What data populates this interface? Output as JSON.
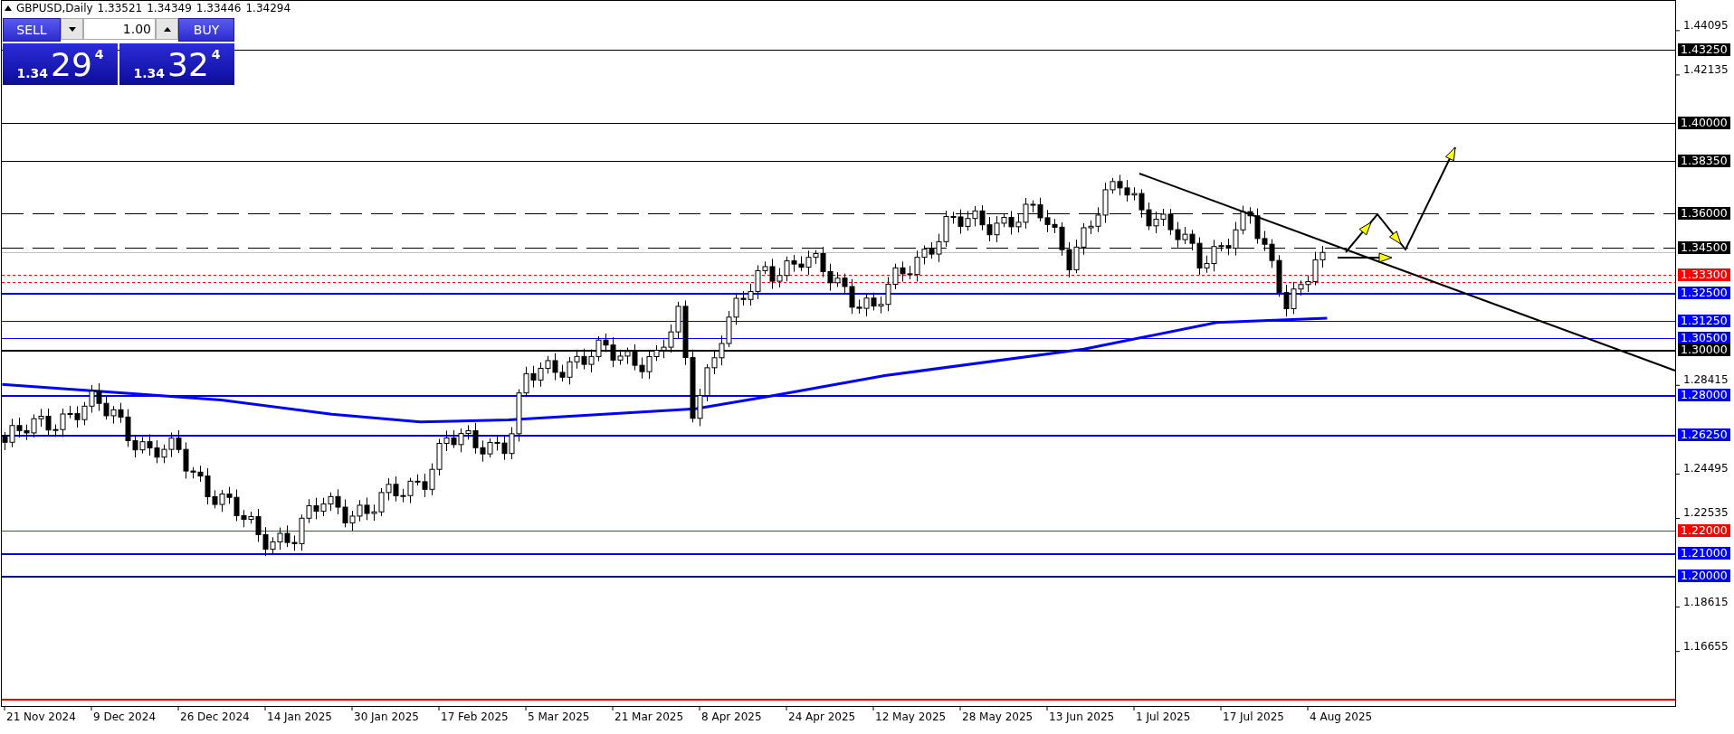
{
  "header": {
    "symbol": "GBPUSD,Daily",
    "ohlc": [
      "1.33521",
      "1.34349",
      "1.33446",
      "1.34294"
    ]
  },
  "trade_panel": {
    "sell": {
      "label": "SELL",
      "price_prefix": "1.34",
      "price_main": "29",
      "price_digit": "4"
    },
    "lot": "1.00",
    "buy": {
      "label": "BUY",
      "price_prefix": "1.34",
      "price_main": "32",
      "price_digit": "4"
    }
  },
  "chart": {
    "price_ticks": [
      "1.44095",
      "1.42135",
      "1.28415",
      "1.24495",
      "1.22535",
      "1.18615",
      "1.16655"
    ],
    "dates": [
      "21 Nov 2024",
      "9 Dec 2024",
      "26 Dec 2024",
      "14 Jan 2025",
      "30 Jan 2025",
      "17 Feb 2025",
      "5 Mar 2025",
      "21 Mar 2025",
      "8 Apr 2025",
      "24 Apr 2025",
      "12 May 2025",
      "28 May 2025",
      "13 Jun 2025",
      "1 Jul 2025",
      "17 Jul 2025",
      "4 Aug 2025"
    ],
    "levels": [
      {
        "label": "1.43250",
        "color": "#000000",
        "kind": "solid"
      },
      {
        "label": "1.40000",
        "color": "#000000",
        "kind": "solid"
      },
      {
        "label": "1.38350",
        "color": "#000000",
        "kind": "solid"
      },
      {
        "label": "1.36000",
        "color": "#000000",
        "kind": "dashed"
      },
      {
        "label": "1.34500",
        "color": "#000000",
        "kind": "dashed"
      },
      {
        "color": "#c0c0c0",
        "kind": "solid"
      },
      {
        "label": "1.33300",
        "color": "#ff0000",
        "kind": "dotted"
      },
      {
        "color": "#ff0000",
        "kind": "dotted"
      },
      {
        "label": "1.32500",
        "color": "#0000ff",
        "kind": "thick"
      },
      {
        "label": "1.31250",
        "color": "#0000ff",
        "kind": "solid"
      },
      {
        "label": "1.30500",
        "color": "#0000ff",
        "kind": "solid"
      },
      {
        "label": "1.30000",
        "color": "#000000",
        "kind": "thick"
      },
      {
        "label": "1.28000",
        "color": "#0000ff",
        "kind": "thick"
      },
      {
        "label": "1.26250",
        "color": "#0000ff",
        "kind": "thick"
      },
      {
        "label": "1.22000",
        "color": "#ff0000",
        "kind": "solid"
      },
      {
        "label": "1.21000",
        "color": "#0000ff",
        "kind": "thick"
      },
      {
        "label": "1.20000",
        "color": "#0000ff",
        "kind": "thick"
      },
      {
        "color": "#ff0000",
        "kind": "thick"
      }
    ]
  }
}
